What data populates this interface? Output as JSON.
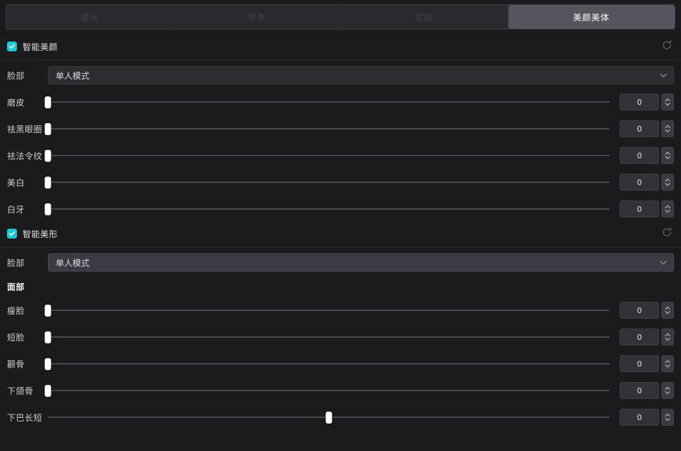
{
  "theme": {
    "bg": "#1b1b1d",
    "accent": "#1fc8d6",
    "tab_active_bg": "#55555d",
    "slider_handle": "#ffffff"
  },
  "tabs": [
    {
      "label": "基础",
      "active": false
    },
    {
      "label": "抠像",
      "active": false
    },
    {
      "label": "蒙版",
      "active": false
    },
    {
      "label": "美颜美体",
      "active": true
    }
  ],
  "sections": [
    {
      "title": "智能美颜",
      "enabled": true,
      "reset_icon": "reset-circular-arrow-icon",
      "dropdown": {
        "label": "脸部",
        "value": "单人模式",
        "hover": false,
        "chevron_icon": "chevron-down-icon"
      },
      "sliders": [
        {
          "label": "磨皮",
          "value": "0",
          "percent": 0
        },
        {
          "label": "祛黑眼圈",
          "value": "0",
          "percent": 0
        },
        {
          "label": "祛法令纹",
          "value": "0",
          "percent": 0
        },
        {
          "label": "美白",
          "value": "0",
          "percent": 0
        },
        {
          "label": "白牙",
          "value": "0",
          "percent": 0
        }
      ]
    },
    {
      "title": "智能美形",
      "enabled": true,
      "reset_icon": "reset-circular-arrow-icon",
      "dropdown": {
        "label": "脸部",
        "value": "单人模式",
        "hover": true,
        "chevron_icon": "chevron-down-icon"
      },
      "group_title": "面部",
      "sliders": [
        {
          "label": "瘦脸",
          "value": "0",
          "percent": 0
        },
        {
          "label": "短脸",
          "value": "0",
          "percent": 0
        },
        {
          "label": "颧骨",
          "value": "0",
          "percent": 0
        },
        {
          "label": "下颌骨",
          "value": "0",
          "percent": 0
        },
        {
          "label": "下巴长短",
          "value": "0",
          "percent": 50
        }
      ]
    }
  ]
}
